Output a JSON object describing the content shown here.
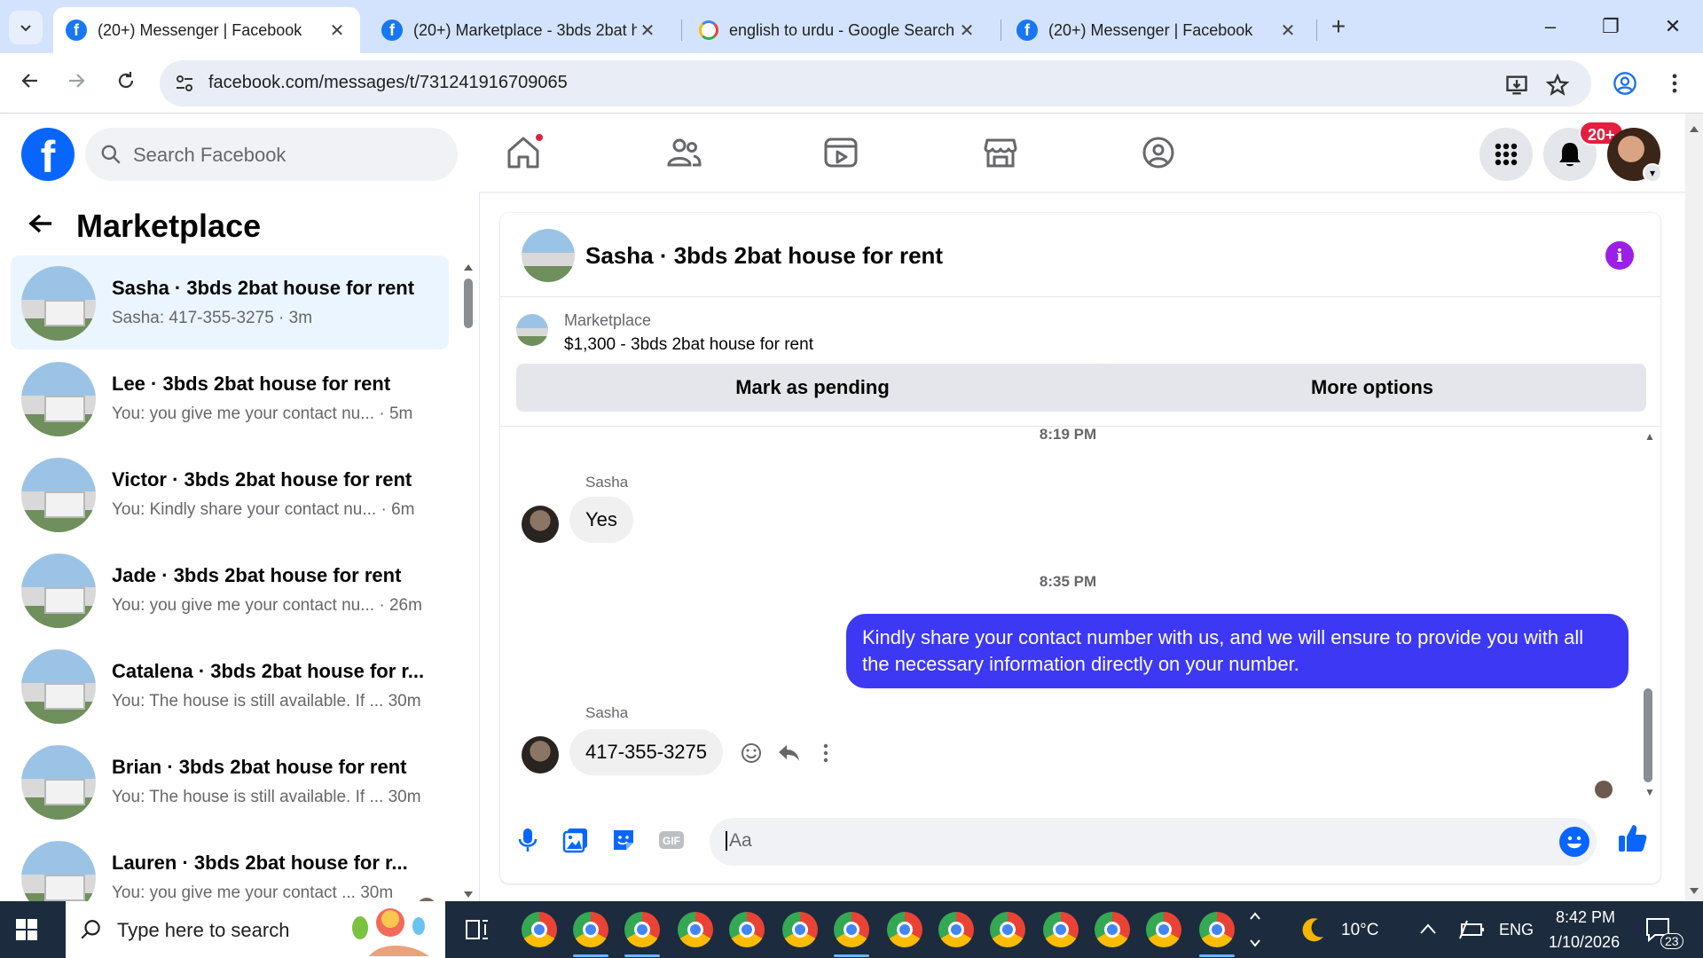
{
  "browser": {
    "tabs": [
      {
        "title": "(20+) Messenger | Facebook",
        "favicon": "facebook-icon",
        "active": true
      },
      {
        "title": "(20+) Marketplace - 3bds 2bat h",
        "favicon": "facebook-icon",
        "active": false
      },
      {
        "title": "english to urdu - Google Search",
        "favicon": "google-icon",
        "active": false
      },
      {
        "title": "(20+) Messenger | Facebook",
        "favicon": "facebook-icon",
        "active": false
      }
    ],
    "url": "facebook.com/messages/t/731241916709065"
  },
  "fbnav": {
    "search_placeholder": "Search Facebook",
    "notification_badge": "20+"
  },
  "sidebar": {
    "title": "Marketplace",
    "chats": [
      {
        "name": "Sasha · 3bds 2bat house for rent",
        "preview": "Sasha: 417-355-3275",
        "time": "3m",
        "active": true
      },
      {
        "name": "Lee · 3bds 2bat house for rent",
        "preview": "You: you give me your contact nu...",
        "time": "5m",
        "active": false
      },
      {
        "name": "Victor · 3bds 2bat house for rent",
        "preview": "You: Kindly share your contact nu...",
        "time": "6m",
        "active": false
      },
      {
        "name": "Jade · 3bds 2bat house for rent",
        "preview": "You: you give me your contact nu...",
        "time": "26m",
        "active": false
      },
      {
        "name": "Catalena · 3bds 2bat house for r...",
        "preview": "You: The house is still available. If ...",
        "time": "30m",
        "active": false
      },
      {
        "name": "Brian · 3bds 2bat house for rent",
        "preview": "You: The house is still available. If ...",
        "time": "30m",
        "active": false
      },
      {
        "name": "Lauren · 3bds 2bat house for r...",
        "preview": "You: you give me your contact ...",
        "time": "30m",
        "active": false
      }
    ]
  },
  "conversation": {
    "title": "Sasha · 3bds 2bat house for rent",
    "listing_label": "Marketplace",
    "listing_item": "$1,300 - 3bds 2bat house for rent",
    "mark_pending": "Mark as pending",
    "more_options": "More options",
    "messages": [
      {
        "type": "timestamp",
        "text": "8:19 PM"
      },
      {
        "type": "sender",
        "text": "Sasha"
      },
      {
        "type": "incoming",
        "text": "Yes"
      },
      {
        "type": "timestamp",
        "text": "8:35 PM"
      },
      {
        "type": "outgoing",
        "text": "Kindly share your contact number with us, and we will ensure to provide you with all the necessary information directly on your number."
      },
      {
        "type": "sender",
        "text": "Sasha"
      },
      {
        "type": "incoming",
        "text": "417-355-3275"
      }
    ],
    "composer_placeholder": "Aa",
    "accent_color": "#3c38f4"
  },
  "taskbar": {
    "search_placeholder": "Type here to search",
    "weather": "10°C",
    "language": "ENG",
    "time": "8:42 PM",
    "date": "1/10/2026",
    "notification_count": "23"
  }
}
